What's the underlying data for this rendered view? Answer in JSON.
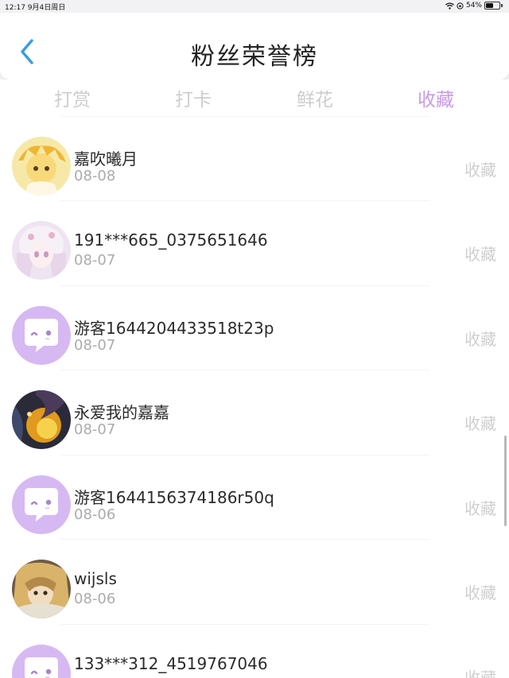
{
  "status_bar": {
    "time_date": "12:17   9月4日周日",
    "battery": "54%",
    "battery_level": 0.54
  },
  "header": {
    "title": "粉丝荣誉榜"
  },
  "tabs": [
    {
      "label": "打赏",
      "active": false
    },
    {
      "label": "打卡",
      "active": false
    },
    {
      "label": "鲜花",
      "active": false
    },
    {
      "label": "收藏",
      "active": true
    }
  ],
  "colors": {
    "accent": "#c79ae6",
    "tab_inactive": "#cdcdcd",
    "label_gray": "#cfcfcf",
    "date_gray": "#ababab",
    "guest_avatar": "#d6b9f2"
  },
  "fans": [
    {
      "nickname": "嘉吹曦月",
      "date": "08-08",
      "type": "收藏",
      "avatar": "anime-yellow"
    },
    {
      "nickname": "191***665_0375651646",
      "date": "08-07",
      "type": "收藏",
      "avatar": "anime-pink"
    },
    {
      "nickname": "游客1644204433518t23p",
      "date": "08-07",
      "type": "收藏",
      "avatar": "guest"
    },
    {
      "nickname": "永爱我的嘉嘉",
      "date": "08-07",
      "type": "收藏",
      "avatar": "fire-painting"
    },
    {
      "nickname": "游客1644156374186r50q",
      "date": "08-06",
      "type": "收藏",
      "avatar": "guest"
    },
    {
      "nickname": "wijsls",
      "date": "08-06",
      "type": "收藏",
      "avatar": "anime-dark"
    },
    {
      "nickname": "133***312_4519767046",
      "date": "",
      "type": "收藏",
      "avatar": "guest"
    }
  ]
}
